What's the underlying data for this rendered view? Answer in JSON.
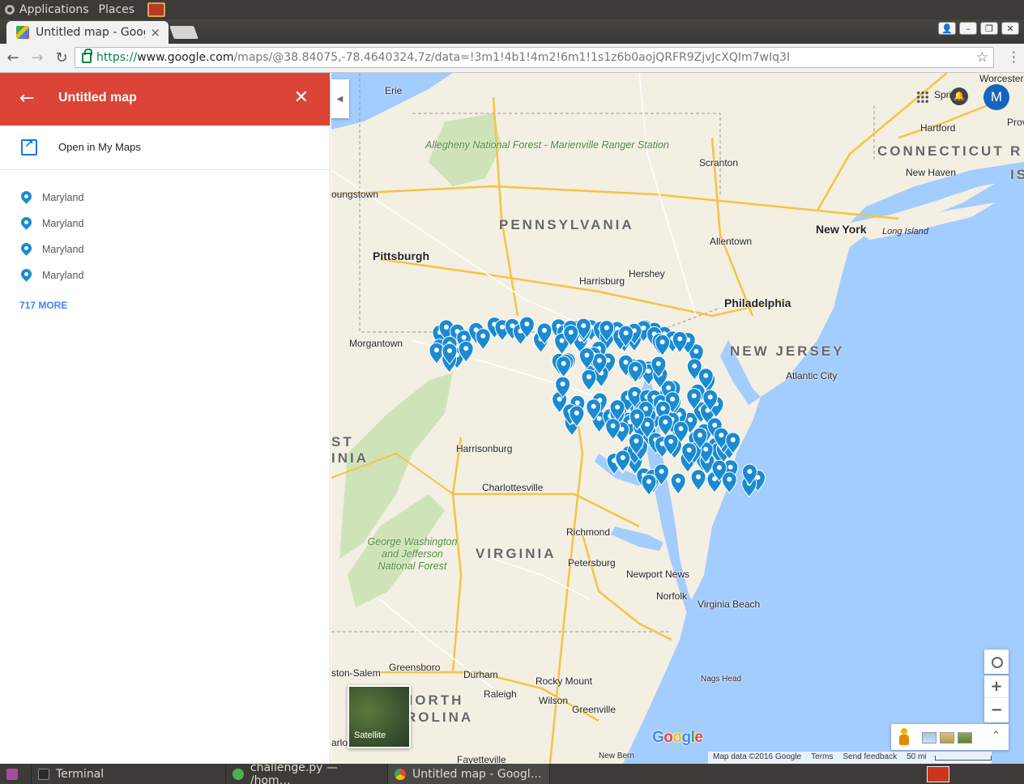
{
  "panel": {
    "applications": "Applications",
    "places": "Places"
  },
  "browser": {
    "tab_title": "Untitled map - Goog",
    "tab_close": "×",
    "url_scheme": "https://",
    "url_host": "www.google.com",
    "url_path": "/maps/@38.84075,-78.4640324,7z/data=!3m1!4b1!4m2!6m1!1s1z6b0aojQRFR9ZjvJcXQIm7wIq3I"
  },
  "side_panel": {
    "title": "Untitled map",
    "open_label": "Open in My Maps",
    "layers": [
      "Maryland",
      "Maryland",
      "Maryland",
      "Maryland"
    ],
    "more_link": "717 MORE"
  },
  "map": {
    "avatar_initial": "M",
    "state_labels": [
      "PENNSYLVANIA",
      "NEW JERSEY",
      "VIRGINIA",
      "CONNECTICUT",
      "NORTH",
      "ROLINA",
      "ST",
      "INIA",
      "R",
      "IS"
    ],
    "cities": [
      "Erie",
      "Pittsburgh",
      "Scranton",
      "Allentown",
      "Harrisburg",
      "Hershey",
      "Philadelphia",
      "New York",
      "Hartford",
      "New Haven",
      "Long Island",
      "Atlantic City",
      "Morgantown",
      "oungstown",
      "Harrisonburg",
      "Charlottesville",
      "Richmond",
      "Petersburg",
      "Newport News",
      "Norfolk",
      "Virginia Beach",
      "Greensboro",
      "Durham",
      "Raleigh",
      "Rocky Mount",
      "Wilson",
      "Greenville",
      "Nags Head",
      "Fayetteville",
      "New Bern",
      "ston-Salem",
      "Springfi",
      "Worcester",
      "Prov",
      "arlo"
    ],
    "forests": [
      "Allegheny National Forest - Marienville Ranger Station",
      "George Washington and Jefferson National Forest"
    ],
    "satellite_label": "Satellite",
    "google_logo": "Google",
    "attribution": [
      "Map data ©2016 Google",
      "Terms",
      "Send feedback",
      "50 mi"
    ],
    "marker_color": "#1a8bd1",
    "marker_count": 721
  },
  "taskbar": {
    "items": [
      "Terminal",
      "challenge.py — /hom…",
      "Untitled map - Googl…"
    ]
  }
}
